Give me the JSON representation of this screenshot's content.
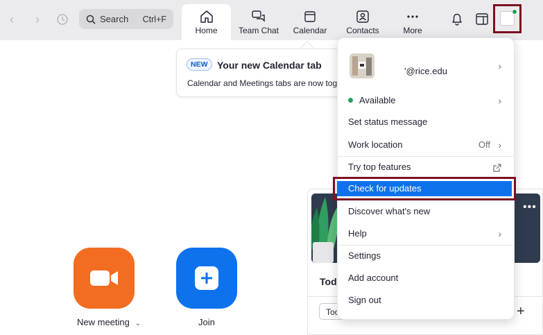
{
  "topbar": {
    "search_label": "Search",
    "search_shortcut": "Ctrl+F",
    "tabs": [
      {
        "label": "Home"
      },
      {
        "label": "Team Chat"
      },
      {
        "label": "Calendar"
      },
      {
        "label": "Contacts"
      },
      {
        "label": "More"
      }
    ]
  },
  "banner": {
    "badge": "NEW",
    "title": "Your new Calendar tab",
    "text": "Calendar and Meetings tabs are now toge"
  },
  "main": {
    "new_meeting_label": "New meeting",
    "join_label": "Join"
  },
  "card": {
    "today_label": "Tod",
    "today_button": "Toc"
  },
  "menu": {
    "email": "'@rice.edu",
    "status": "Available",
    "set_status": "Set status message",
    "work_location": "Work location",
    "work_location_value": "Off",
    "try_top_features": "Try top features",
    "check_for_updates": "Check for updates",
    "discover_new": "Discover what's new",
    "help": "Help",
    "settings": "Settings",
    "add_account": "Add account",
    "sign_out": "Sign out"
  },
  "colors": {
    "accent": "#0e72ed",
    "orange": "#f26d21",
    "highlight_border": "#7b1120",
    "status_green": "#1ba35b"
  }
}
